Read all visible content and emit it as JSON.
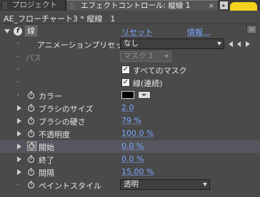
{
  "tabs": {
    "project": "プロジェクト",
    "effect_controls": "エフェクトコントロール: 縦線 1",
    "close": "×",
    "menu": "▸"
  },
  "header": {
    "text": "AE_フローチャート3 * 縦線　1"
  },
  "effect": {
    "badge": "f",
    "name": "線",
    "reset_label": "リセット",
    "about_label": "情報..."
  },
  "animation_preset": {
    "label": "アニメーションプリセット :",
    "value": "なし"
  },
  "path": {
    "label": "パス",
    "value": "マスク 1"
  },
  "all_masks": {
    "label": "すべてのマスク",
    "checked": true
  },
  "stroke_sequentially": {
    "label": "線(連続)",
    "checked": true
  },
  "properties": [
    {
      "label": "カラー"
    },
    {
      "label": "ブラシのサイズ",
      "value": "2.0"
    },
    {
      "label": "ブラシの硬さ",
      "value": "79 %"
    },
    {
      "label": "不透明度",
      "value": "100.0 %"
    },
    {
      "label": "開始",
      "value": "0.0 %"
    },
    {
      "label": "終了",
      "value": "0.0 %"
    },
    {
      "label": "間隔",
      "value": "15.00 %"
    },
    {
      "label": "ペイントスタイル",
      "value": "透明"
    }
  ],
  "colors": {
    "link": "#7aa7ff",
    "selected_row": "#56565f",
    "stroke_color": "#000000",
    "tab_highlight": "#f2d21b"
  }
}
